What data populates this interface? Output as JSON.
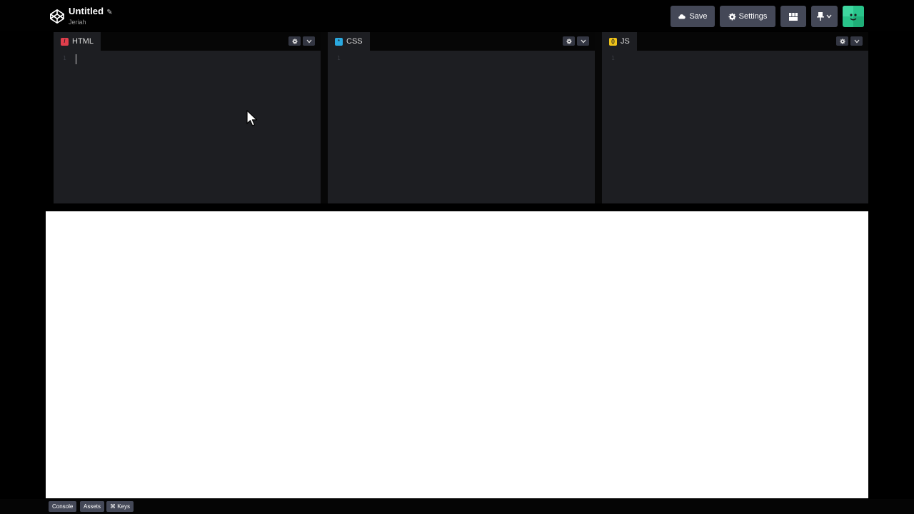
{
  "header": {
    "title": "Untitled",
    "author": "Jeriah",
    "save_label": "Save",
    "settings_label": "Settings",
    "icons": {
      "logo": "codepen-logo-icon",
      "edit": "pencil-icon",
      "save": "cloud-icon",
      "settings": "gear-icon",
      "layout": "layout-grid-icon",
      "pin": "pin-icon"
    }
  },
  "editors": [
    {
      "label": "HTML",
      "badge_color": "#e03e4c",
      "line": "1"
    },
    {
      "label": "CSS",
      "badge_color": "#2aa9e0",
      "line": "1"
    },
    {
      "label": "JS",
      "badge_color": "#f0c419",
      "line": "1"
    }
  ],
  "footer": {
    "console_label": "Console",
    "assets_label": "Assets",
    "keys_label": "⌘ Keys"
  },
  "colors": {
    "background": "#000000",
    "editor_bg": "#1d1e22",
    "button_bg": "#444857",
    "avatar_bg": "#29c48b"
  }
}
